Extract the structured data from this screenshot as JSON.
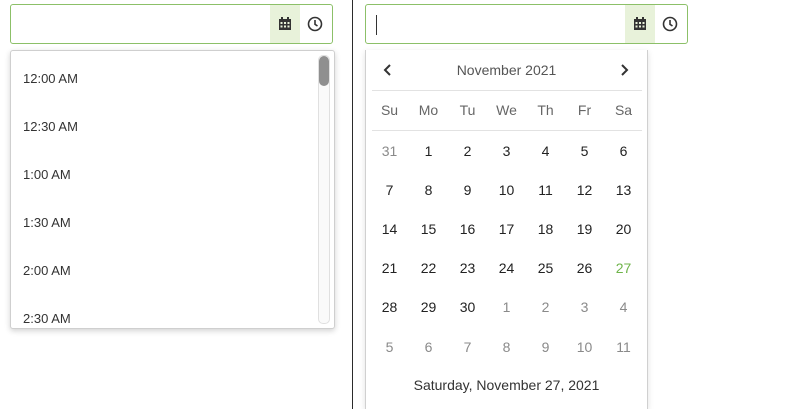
{
  "time_picker": {
    "input_value": "",
    "times": [
      "12:00 AM",
      "12:30 AM",
      "1:00 AM",
      "1:30 AM",
      "2:00 AM",
      "2:30 AM"
    ]
  },
  "date_picker": {
    "input_value": "",
    "month_label": "November 2021",
    "prev_icon": "chevron-left-icon",
    "next_icon": "chevron-right-icon",
    "weekdays": [
      "Su",
      "Mo",
      "Tu",
      "We",
      "Th",
      "Fr",
      "Sa"
    ],
    "weeks": [
      [
        {
          "d": "31",
          "o": true
        },
        {
          "d": "1"
        },
        {
          "d": "2"
        },
        {
          "d": "3"
        },
        {
          "d": "4"
        },
        {
          "d": "5"
        },
        {
          "d": "6"
        }
      ],
      [
        {
          "d": "7"
        },
        {
          "d": "8"
        },
        {
          "d": "9"
        },
        {
          "d": "10"
        },
        {
          "d": "11"
        },
        {
          "d": "12"
        },
        {
          "d": "13"
        }
      ],
      [
        {
          "d": "14"
        },
        {
          "d": "15"
        },
        {
          "d": "16"
        },
        {
          "d": "17"
        },
        {
          "d": "18"
        },
        {
          "d": "19"
        },
        {
          "d": "20"
        }
      ],
      [
        {
          "d": "21"
        },
        {
          "d": "22"
        },
        {
          "d": "23"
        },
        {
          "d": "24"
        },
        {
          "d": "25"
        },
        {
          "d": "26"
        },
        {
          "d": "27",
          "today": true
        }
      ],
      [
        {
          "d": "28"
        },
        {
          "d": "29"
        },
        {
          "d": "30"
        },
        {
          "d": "1",
          "o": true
        },
        {
          "d": "2",
          "o": true
        },
        {
          "d": "3",
          "o": true
        },
        {
          "d": "4",
          "o": true
        }
      ],
      [
        {
          "d": "5",
          "o": true
        },
        {
          "d": "6",
          "o": true
        },
        {
          "d": "7",
          "o": true
        },
        {
          "d": "8",
          "o": true
        },
        {
          "d": "9",
          "o": true
        },
        {
          "d": "10",
          "o": true
        },
        {
          "d": "11",
          "o": true
        }
      ]
    ],
    "today_footer": "Saturday, November 27, 2021"
  },
  "icons": {
    "calendar": "calendar-icon",
    "clock": "clock-icon"
  },
  "colors": {
    "accent_border": "#8cc068",
    "addon_bg": "#e8f2da",
    "today": "#6fb44a"
  }
}
